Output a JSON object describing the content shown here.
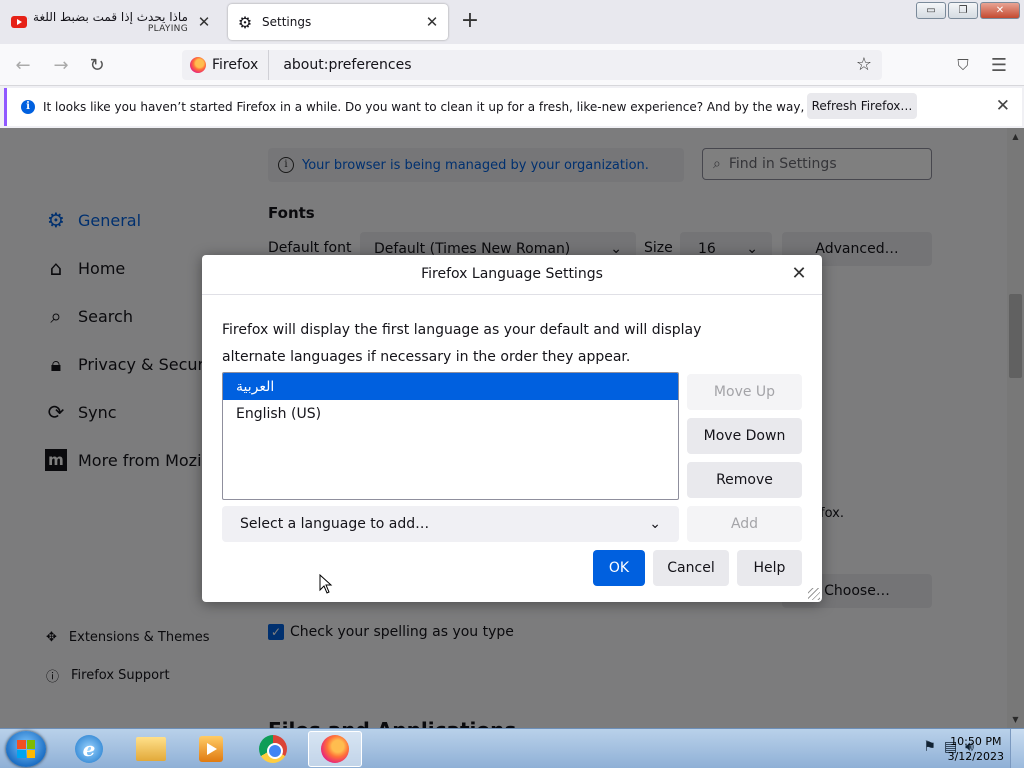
{
  "browser": {
    "tabs": [
      {
        "title": "ماذا يحدث إذا قمت بضبط اللغة على",
        "status": "PLAYING",
        "icon": "youtube-icon"
      },
      {
        "title": "Settings",
        "icon": "gear-icon"
      }
    ],
    "new_tab": "+",
    "window_controls": {
      "minimize": "▭",
      "restore": "❐",
      "close": "✕"
    },
    "identity_label": "Firefox",
    "url": "about:preferences"
  },
  "notification": {
    "message": "It looks like you haven’t started Firefox in a while. Do you want to clean it up for a fresh, like-new experience? And by the way, welcome back!",
    "button": "Refresh Firefox…"
  },
  "settings": {
    "managed_notice": "Your browser is being managed by your organization.",
    "find_placeholder": "Find in Settings",
    "nav": [
      "General",
      "Home",
      "Search",
      "Privacy & Security",
      "Sync",
      "More from Mozilla"
    ],
    "footer_links": [
      "Extensions & Themes",
      "Firefox Support"
    ],
    "fonts_heading": "Fonts",
    "default_font_label": "Default font",
    "default_font_value": "Default (Times New Roman)",
    "size_label": "Size",
    "size_value": "16",
    "advanced_button": "Advanced…",
    "fox_text": "fox.",
    "choose_button": "Choose…",
    "spell_check_label": "Check your spelling as you type",
    "files_heading": "Files and Applications"
  },
  "dialog": {
    "title": "Firefox Language Settings",
    "description": "Firefox will display the first language as your default and will display alternate languages if necessary in the order they appear.",
    "languages": [
      "العربية",
      "English (US)"
    ],
    "selected_index": 0,
    "buttons": {
      "move_up": "Move Up",
      "move_down": "Move Down",
      "remove": "Remove",
      "add": "Add",
      "ok": "OK",
      "cancel": "Cancel",
      "help": "Help"
    },
    "select_placeholder": "Select a language to add…"
  },
  "taskbar": {
    "apps": [
      "internet-explorer-icon",
      "file-explorer-icon",
      "media-player-icon",
      "chrome-icon",
      "firefox-icon"
    ],
    "time": "10:50 PM",
    "date": "3/12/2023"
  },
  "colors": {
    "accent": "#0060df",
    "notification_border": "#9059ff"
  }
}
